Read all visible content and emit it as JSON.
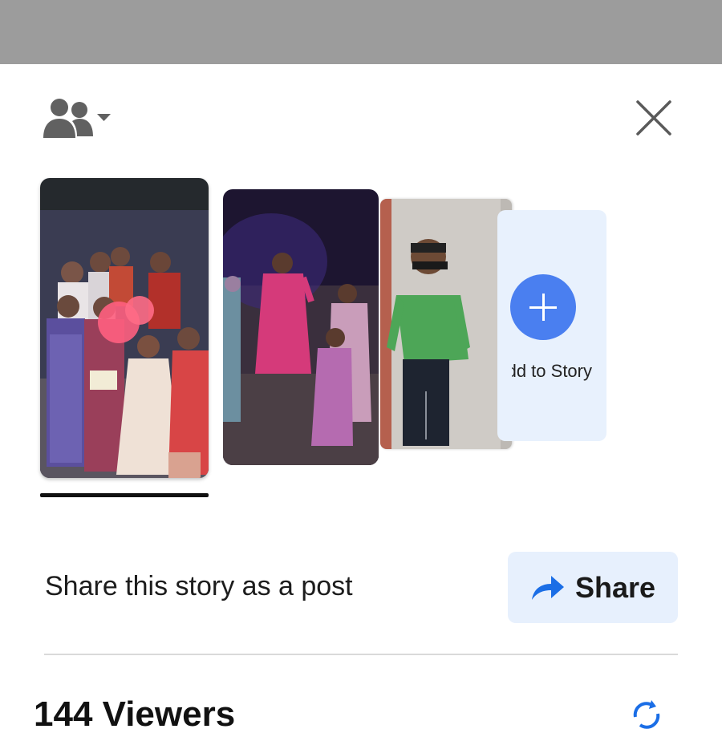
{
  "header": {
    "audience_icon": "people-icon",
    "audience_dropdown_icon": "caret-down-icon",
    "close_icon": "close-icon"
  },
  "stories": [
    {
      "name": "story-1",
      "active": true
    },
    {
      "name": "story-2",
      "active": false
    },
    {
      "name": "story-3",
      "active": false
    }
  ],
  "add_story": {
    "label": "Add to Story",
    "icon": "plus-icon"
  },
  "share_section": {
    "text": "Share this story as a post",
    "button_label": "Share",
    "button_icon": "share-arrow-icon"
  },
  "viewers": {
    "title": "144 Viewers",
    "refresh_icon": "refresh-icon"
  },
  "colors": {
    "accent": "#4a7ff0",
    "share_bg": "#e7f0fd",
    "add_card_bg": "#e8f1fd"
  }
}
